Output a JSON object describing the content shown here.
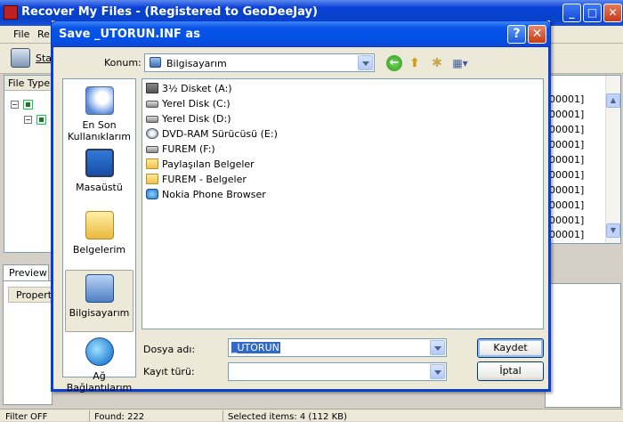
{
  "app": {
    "title": "Recover My Files  -  (Registered to GeoDeeJay)",
    "menu": [
      "File",
      "Re"
    ],
    "toolbar_label": "Sta",
    "left_pane_header": "File Type",
    "preview_tab": "Preview",
    "property_header": "Property",
    "right_rows": [
      "00001]",
      "00001]",
      "00001]",
      "00001]",
      "00001]",
      "00001]",
      "00001]",
      "00001]",
      "00001]",
      "00001]"
    ],
    "status": {
      "filter": "Filter OFF",
      "found": "Found: 222",
      "selected": "Selected items: 4 (112 KB)"
    }
  },
  "dialog": {
    "title": "Save _UTORUN.INF as",
    "help_glyph": "?",
    "close_glyph": "✕",
    "konum_label": "Konum:",
    "konum_value": "Bilgisayarım",
    "places": [
      {
        "label": "En Son Kullanıklarım",
        "icon": "recent-documents-icon"
      },
      {
        "label": "Masaüstü",
        "icon": "desktop-icon"
      },
      {
        "label": "Belgelerim",
        "icon": "my-documents-icon"
      },
      {
        "label": "Bilgisayarım",
        "icon": "my-computer-icon"
      },
      {
        "label": "Ağ Bağlantılarım",
        "icon": "network-places-icon"
      }
    ],
    "files": [
      {
        "name": "3½ Disket (A:)",
        "icon": "floppy-drive-icon"
      },
      {
        "name": "Yerel Disk (C:)",
        "icon": "hard-disk-icon"
      },
      {
        "name": "Yerel Disk (D:)",
        "icon": "hard-disk-icon"
      },
      {
        "name": "DVD-RAM Sürücüsü (E:)",
        "icon": "dvd-drive-icon"
      },
      {
        "name": "FUREM (F:)",
        "icon": "hard-disk-icon"
      },
      {
        "name": "Paylaşılan Belgeler",
        "icon": "folder-icon"
      },
      {
        "name": "FUREM - Belgeler",
        "icon": "folder-icon"
      },
      {
        "name": "Nokia Phone Browser",
        "icon": "phone-browser-icon"
      }
    ],
    "filename_label": "Dosya adı:",
    "filename_value": "_UTORUN",
    "filetype_label": "Kayıt türü:",
    "filetype_value": "",
    "save_label": "Kaydet",
    "cancel_label": "İptal"
  }
}
